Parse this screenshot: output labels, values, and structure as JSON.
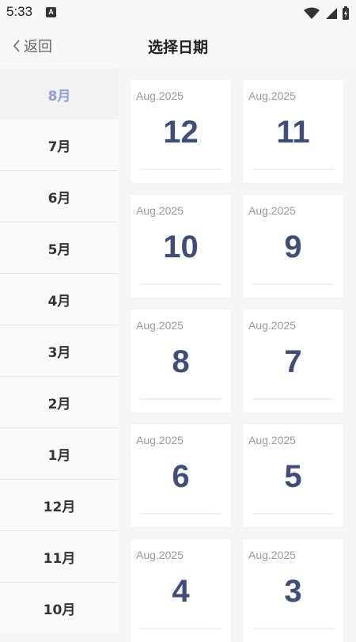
{
  "status": {
    "time": "5:33",
    "notif_letter": "A"
  },
  "header": {
    "back_label": "返回",
    "title": "选择日期"
  },
  "sidebar": {
    "items": [
      {
        "label": "8月",
        "active": true
      },
      {
        "label": "7月"
      },
      {
        "label": "6月"
      },
      {
        "label": "5月"
      },
      {
        "label": "4月"
      },
      {
        "label": "3月"
      },
      {
        "label": "2月"
      },
      {
        "label": "1月"
      },
      {
        "label": "12月"
      },
      {
        "label": "11月"
      },
      {
        "label": "10月"
      }
    ]
  },
  "days": [
    {
      "month": "Aug.2025",
      "day": "12"
    },
    {
      "month": "Aug.2025",
      "day": "11"
    },
    {
      "month": "Aug.2025",
      "day": "10"
    },
    {
      "month": "Aug.2025",
      "day": "9"
    },
    {
      "month": "Aug.2025",
      "day": "8"
    },
    {
      "month": "Aug.2025",
      "day": "7"
    },
    {
      "month": "Aug.2025",
      "day": "6"
    },
    {
      "month": "Aug.2025",
      "day": "5"
    },
    {
      "month": "Aug.2025",
      "day": "4"
    },
    {
      "month": "Aug.2025",
      "day": "3"
    }
  ],
  "colors": {
    "accent": "#8b9fd8",
    "day_number": "#3e4d7a"
  }
}
